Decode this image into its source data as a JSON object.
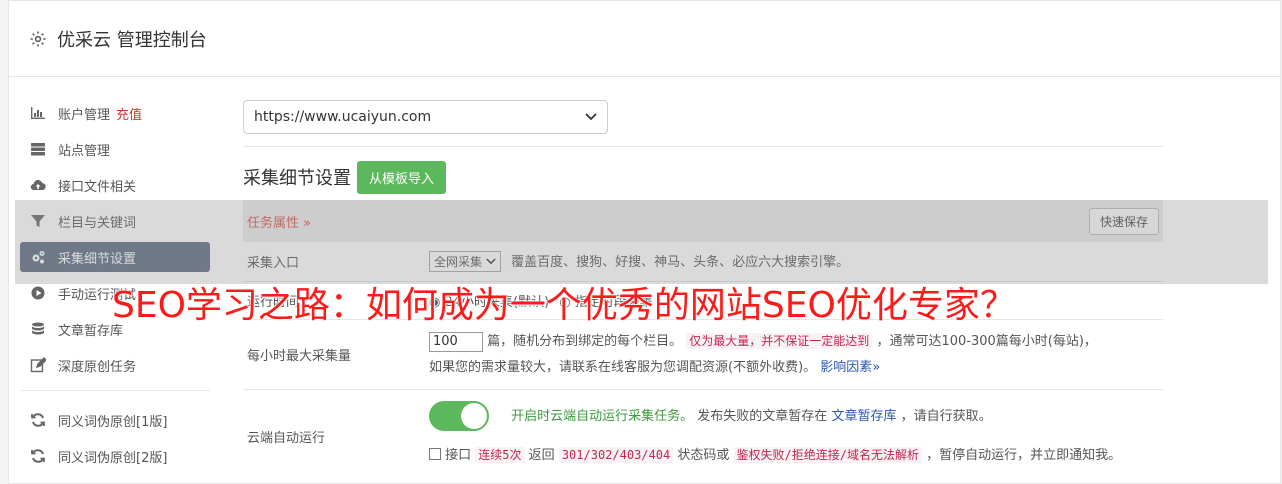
{
  "header": {
    "title": "优采云 管理控制台"
  },
  "sidebar": {
    "items": [
      {
        "label": "账户管理",
        "badge": "充值",
        "icon": "bar-chart-icon"
      },
      {
        "label": "站点管理",
        "icon": "server-icon"
      },
      {
        "label": "接口文件相关",
        "icon": "cloud-upload-icon"
      },
      {
        "label": "栏目与关键词",
        "icon": "filter-icon"
      },
      {
        "label": "采集细节设置",
        "icon": "gears-icon",
        "active": true
      },
      {
        "label": "手动运行测试",
        "icon": "play-circle-icon"
      },
      {
        "label": "文章暂存库",
        "icon": "database-icon"
      },
      {
        "label": "深度原创任务",
        "icon": "edit-icon"
      },
      {
        "label": "同义词伪原创[1版]",
        "icon": "refresh-icon"
      },
      {
        "label": "同义词伪原创[2版]",
        "icon": "refresh-icon"
      }
    ]
  },
  "main": {
    "site_select": "https://www.ucaiyun.com",
    "section_title": "采集细节设置",
    "import_button": "从模板导入",
    "task_title": "任务属性",
    "quick_save": "快速保存",
    "entry": {
      "label": "采集入口",
      "select": "全网采集",
      "desc": "覆盖百度、搜狗、好搜、神马、头条、必应六大搜索引擎。"
    },
    "runtime": {
      "label": "运行时间",
      "opt1": "24小时采集(默认)",
      "opt2": "指定时段采集"
    },
    "max": {
      "label": "每小时最大采集量",
      "value": "100",
      "t1": "篇，随机分布到绑定的每个栏目。",
      "t2": "仅为最大量，并不保证一定能达到",
      "t3": "，通常可达100-300篇每小时(每站)，",
      "t4": "如果您的需求量较大，请联系在线客服为您调配资源(不额外收费)。",
      "t5": "影响因素"
    },
    "cloud": {
      "label": "云端自动运行",
      "green": "开启时云端自动运行采集任务。",
      "t1": "发布失败的文章暂存在",
      "link": "文章暂存库",
      "t2": "，请自行获取。",
      "c1": "接口",
      "c2": "连续5次",
      "c3": "返回",
      "c4": "301/302/403/404",
      "c5": "状态码或",
      "c6": "鉴权失败/拒绝连接/域名无法解析",
      "c7": "，暂停自动运行，并立即通知我。"
    }
  },
  "overlay_title": "SEO学习之路：如何成为一个优秀的网站SEO优化专家？"
}
